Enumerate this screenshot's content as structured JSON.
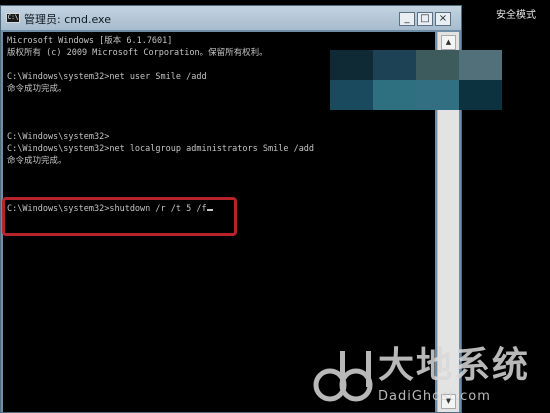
{
  "desktop": {
    "safe_mode_label": "安全模式"
  },
  "window": {
    "title": "管理员: cmd.exe",
    "icon_text": "C:\\",
    "buttons": {
      "minimize": "_",
      "maximize": "□",
      "close": "×"
    }
  },
  "console": {
    "lines": [
      "Microsoft Windows [版本 6.1.7601]",
      "版权所有 (c) 2009 Microsoft Corporation。保留所有权利。",
      "",
      "C:\\Windows\\system32>net user Smile /add",
      "命令成功完成。",
      "",
      "",
      "",
      "C:\\Windows\\system32>",
      "C:\\Windows\\system32>net localgroup administrators Smile /add",
      "命令成功完成。",
      "",
      "",
      "",
      "C:\\Windows\\system32>shutdown /r /t 5 /f"
    ]
  },
  "scrollbar": {
    "up_arrow": "▲",
    "down_arrow": "▼"
  },
  "watermark": {
    "chinese": "大地系统",
    "english": "DadiGhost.com"
  },
  "colors": {
    "console_bg": "#000000",
    "console_text": "#c4c4c4",
    "highlight": "#b7232b",
    "titlebar": "#b5c8d7"
  },
  "mosaic_colors": [
    [
      "#0f2a35",
      "#1d4256",
      "#3d5a5c",
      "#52707a"
    ],
    [
      "#1a4a5e",
      "#2e7080",
      "#326f83",
      "#0c3240"
    ]
  ]
}
